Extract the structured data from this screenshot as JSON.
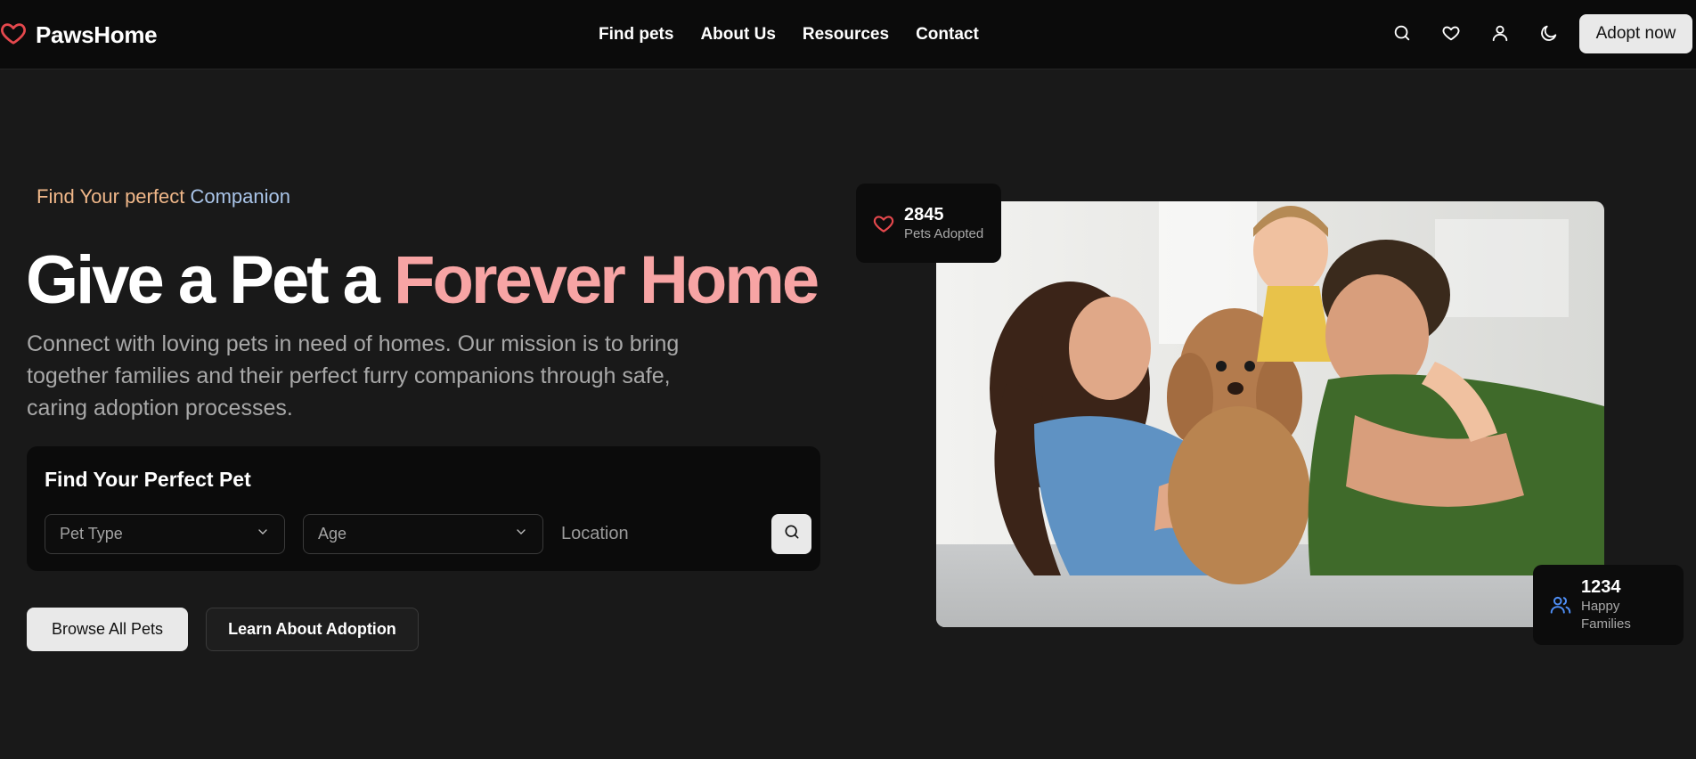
{
  "brand": {
    "name": "PawsHome",
    "icon": "heart-icon",
    "accent": "#e5484d"
  },
  "nav": {
    "links": [
      "Find pets",
      "About Us",
      "Resources",
      "Contact"
    ],
    "icons": [
      "search-icon",
      "heart-icon",
      "user-icon",
      "moon-icon"
    ],
    "cta": "Adopt now"
  },
  "hero": {
    "tagline_part1": "Find Your perfect",
    "tagline_part2": " Companion",
    "headline_part1": "Give a Pet a ",
    "headline_accent": "Forever Home",
    "description": "Connect with loving pets in need of homes. Our mission is to bring together families and their perfect furry companions through safe, caring adoption processes.",
    "accent_color": "#f7a4a4"
  },
  "search": {
    "title": "Find Your Perfect Pet",
    "pet_type": "Pet Type",
    "age": "Age",
    "location_placeholder": "Location",
    "button_icon": "search-icon"
  },
  "actions": {
    "browse": "Browse All Pets",
    "learn": "Learn About Adoption"
  },
  "stats": {
    "adopted": {
      "value": "2845",
      "label": "Pets Adopted",
      "icon": "heart-icon",
      "color": "#e5484d"
    },
    "families": {
      "value": "1234",
      "label": "Happy Families",
      "icon": "users-icon",
      "color": "#4f8ff7"
    }
  }
}
